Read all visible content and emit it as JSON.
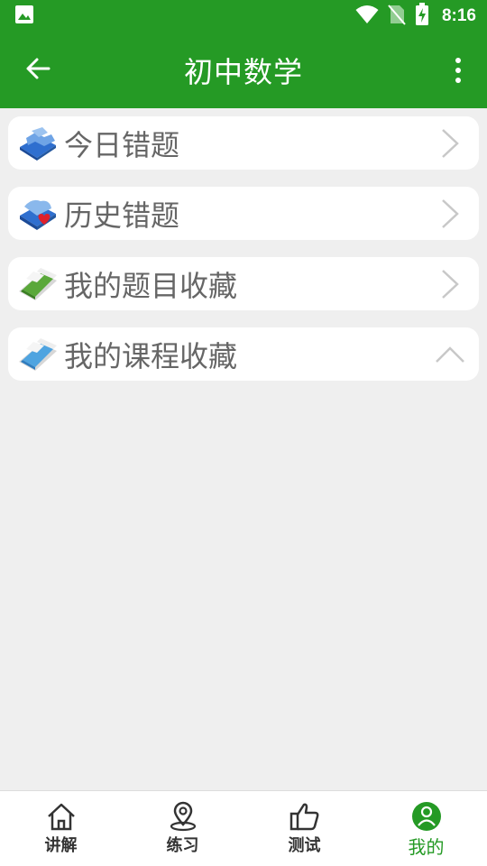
{
  "status_bar": {
    "time": "8:16",
    "icons": [
      "image-icon",
      "wifi-icon",
      "no-sim-icon",
      "battery-charging-icon"
    ]
  },
  "app_bar": {
    "title": "初中数学",
    "back_icon": "arrow-left-icon",
    "menu_icon": "more-vert-icon"
  },
  "list": {
    "items": [
      {
        "label": "今日错题",
        "icon": "puzzle-folder-icon",
        "trailing": "chevron-right-icon"
      },
      {
        "label": "历史错题",
        "icon": "heart-folder-icon",
        "trailing": "chevron-right-icon"
      },
      {
        "label": "我的题目收藏",
        "icon": "green-book-icon",
        "trailing": "chevron-right-icon"
      },
      {
        "label": "我的课程收藏",
        "icon": "blue-book-icon",
        "trailing": "chevron-up-icon"
      }
    ]
  },
  "tabs": [
    {
      "label": "讲解",
      "icon": "home-icon",
      "active": false
    },
    {
      "label": "练习",
      "icon": "location-pin-icon",
      "active": false
    },
    {
      "label": "测试",
      "icon": "thumbs-up-icon",
      "active": false
    },
    {
      "label": "我的",
      "icon": "person-circle-icon",
      "active": true
    }
  ],
  "colors": {
    "primary": "#259a25",
    "background": "#efefef",
    "row_text": "#666666"
  }
}
